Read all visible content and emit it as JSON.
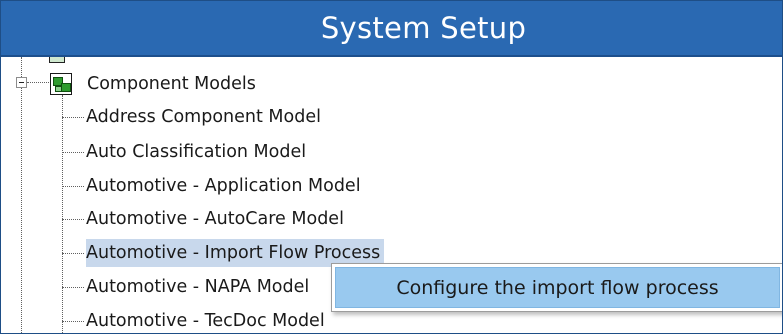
{
  "window": {
    "title": "System Setup"
  },
  "tree": {
    "root": {
      "label": "Component Models",
      "icon": "component-models-icon",
      "expanded": true
    },
    "children": [
      {
        "label": "Address Component Model",
        "selected": false
      },
      {
        "label": "Auto Classification Model",
        "selected": false
      },
      {
        "label": "Automotive - Application Model",
        "selected": false
      },
      {
        "label": "Automotive - AutoCare Model",
        "selected": false
      },
      {
        "label": "Automotive - Import Flow Process",
        "selected": true
      },
      {
        "label": "Automotive - NAPA Model",
        "selected": false
      },
      {
        "label": "Automotive - TecDoc Model",
        "selected": false
      }
    ]
  },
  "context_menu": {
    "items": [
      {
        "label": "Configure the import flow process",
        "highlighted": true
      }
    ]
  },
  "colors": {
    "titlebar": "#2a69b2",
    "selection": "#c8d8ec",
    "menu_highlight": "#99c9ef"
  }
}
